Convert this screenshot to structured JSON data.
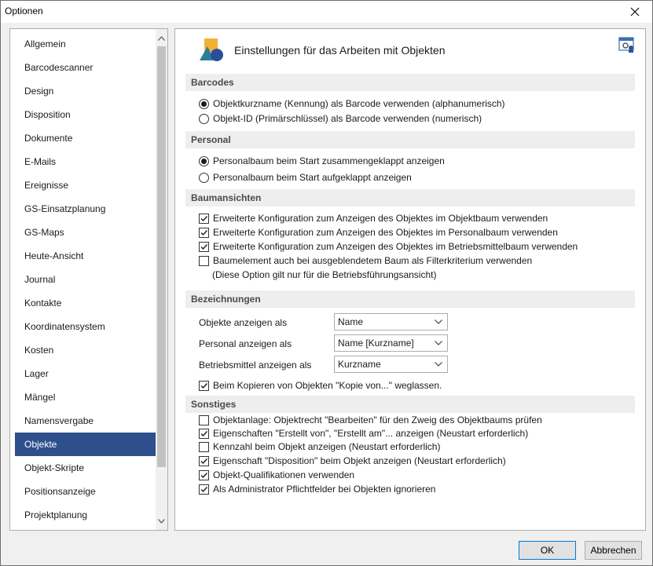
{
  "window": {
    "title": "Optionen"
  },
  "sidebar": {
    "items": [
      {
        "label": "Allgemein",
        "selected": false
      },
      {
        "label": "Barcodescanner",
        "selected": false
      },
      {
        "label": "Design",
        "selected": false
      },
      {
        "label": "Disposition",
        "selected": false
      },
      {
        "label": "Dokumente",
        "selected": false
      },
      {
        "label": "E-Mails",
        "selected": false
      },
      {
        "label": "Ereignisse",
        "selected": false
      },
      {
        "label": "GS-Einsatzplanung",
        "selected": false
      },
      {
        "label": "GS-Maps",
        "selected": false
      },
      {
        "label": "Heute-Ansicht",
        "selected": false
      },
      {
        "label": "Journal",
        "selected": false
      },
      {
        "label": "Kontakte",
        "selected": false
      },
      {
        "label": "Koordinatensystem",
        "selected": false
      },
      {
        "label": "Kosten",
        "selected": false
      },
      {
        "label": "Lager",
        "selected": false
      },
      {
        "label": "Mängel",
        "selected": false
      },
      {
        "label": "Namensvergabe",
        "selected": false
      },
      {
        "label": "Objekte",
        "selected": true
      },
      {
        "label": "Objekt-Skripte",
        "selected": false
      },
      {
        "label": "Positionsanzeige",
        "selected": false
      },
      {
        "label": "Projektplanung",
        "selected": false
      }
    ]
  },
  "content": {
    "title": "Einstellungen für das Arbeiten mit Objekten",
    "barcodes": {
      "header": "Barcodes",
      "opt1": "Objektkurzname (Kennung) als Barcode verwenden (alphanumerisch)",
      "opt1_checked": true,
      "opt2": "Objekt-ID (Primärschlüssel) als Barcode verwenden (numerisch)",
      "opt2_checked": false
    },
    "personal": {
      "header": "Personal",
      "opt1": "Personalbaum beim Start zusammengeklappt anzeigen",
      "opt1_checked": true,
      "opt2": "Personalbaum beim Start aufgeklappt anzeigen",
      "opt2_checked": false
    },
    "baumansichten": {
      "header": "Baumansichten",
      "opt1": "Erweiterte Konfiguration zum Anzeigen des Objektes im Objektbaum verwenden",
      "opt1_checked": true,
      "opt2": "Erweiterte Konfiguration zum Anzeigen des Objektes im Personalbaum verwenden",
      "opt2_checked": true,
      "opt3": "Erweiterte Konfiguration zum Anzeigen des Objektes im Betriebsmittelbaum verwenden",
      "opt3_checked": true,
      "opt4": "Baumelement auch bei ausgeblendetem Baum als Filterkriterium verwenden",
      "opt4_checked": false,
      "note": "(Diese Option gilt nur für die Betriebsführungsansicht)"
    },
    "bezeichnungen": {
      "header": "Bezeichnungen",
      "obj_label": "Objekte anzeigen als",
      "obj_value": "Name",
      "pers_label": "Personal anzeigen als",
      "pers_value": "Name [Kurzname]",
      "bm_label": "Betriebsmittel anzeigen als",
      "bm_value": "Kurzname",
      "copy_opt": "Beim Kopieren von Objekten \"Kopie von...\" weglassen.",
      "copy_checked": true
    },
    "sonstiges": {
      "header": "Sonstiges",
      "opt1": "Objektanlage: Objektrecht \"Bearbeiten\" für den Zweig des Objektbaums prüfen",
      "opt1_checked": false,
      "opt2": "Eigenschaften \"Erstellt von\", \"Erstellt am\"... anzeigen (Neustart erforderlich)",
      "opt2_checked": true,
      "opt3": "Kennzahl beim Objekt anzeigen (Neustart erforderlich)",
      "opt3_checked": false,
      "opt4": "Eigenschaft \"Disposition\" beim Objekt anzeigen (Neustart erforderlich)",
      "opt4_checked": true,
      "opt5": "Objekt-Qualifikationen verwenden",
      "opt5_checked": true,
      "opt6": "Als Administrator Pflichtfelder bei Objekten ignorieren",
      "opt6_checked": true
    }
  },
  "buttons": {
    "ok": "OK",
    "cancel": "Abbrechen"
  },
  "icons": {
    "close": "close-icon",
    "header": "objects-shapes-icon",
    "settings": "settings-window-icon",
    "scroll_up": "chevron-up-icon",
    "scroll_down": "chevron-down-icon",
    "dropdown": "chevron-down-icon"
  },
  "colors": {
    "selected_bg": "#2e4f8c",
    "section_bg": "#eeeeee",
    "accent": "#0078d7"
  }
}
